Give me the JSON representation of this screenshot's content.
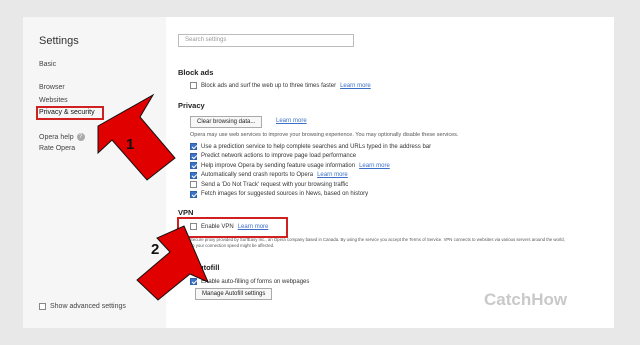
{
  "sidebar": {
    "title": "Settings",
    "items": [
      {
        "label": "Basic"
      },
      {
        "label": "Browser"
      },
      {
        "label": "Websites"
      },
      {
        "label": "Privacy & security"
      },
      {
        "label": "Opera help"
      },
      {
        "label": "Rate Opera"
      }
    ],
    "help_icon": "?",
    "show_advanced": "Show advanced settings"
  },
  "search": {
    "placeholder": "Search settings"
  },
  "block_ads": {
    "title": "Block ads",
    "option": "Block ads and surf the web up to three times faster",
    "link": "Learn more"
  },
  "privacy": {
    "title": "Privacy",
    "clear_button": "Clear browsing data...",
    "clear_link": "Learn more",
    "description": "Opera may use web services to improve your browsing experience. You may optionally disable these services.",
    "options": [
      {
        "label": "Use a prediction service to help complete searches and URLs typed in the address bar",
        "checked": true
      },
      {
        "label": "Predict network actions to improve page load performance",
        "checked": true
      },
      {
        "label": "Help improve Opera by sending feature usage information",
        "checked": true,
        "link": "Learn more"
      },
      {
        "label": "Automatically send crash reports to Opera",
        "checked": true,
        "link": "Learn more"
      },
      {
        "label": "Send a 'Do Not Track' request with your browsing traffic",
        "checked": false
      },
      {
        "label": "Fetch images for suggested sources in News, based on history",
        "checked": true
      }
    ]
  },
  "vpn": {
    "title": "VPN",
    "option": "Enable VPN",
    "link": "Learn more",
    "description": "Secure proxy provided by SurfEasy Inc., an Opera company based in Canada. By using the service you accept the Terms of Service. VPN connects to websites via various servers around the world, so your connection speed might be affected.",
    "terms_link": "Terms of Service"
  },
  "autofill": {
    "title": "Autofill",
    "title_visible": "utofill",
    "option": "Enable auto-filling of forms on webpages",
    "button": "Manage Autofill settings"
  },
  "annotations": {
    "step1": "1",
    "step2": "2",
    "highlight_color": "#d02020",
    "arrow_color": "#e00000"
  },
  "watermark": "CatchHow",
  "colors": {
    "link": "#3b6fc7",
    "checkbox": "#3b73c7"
  }
}
